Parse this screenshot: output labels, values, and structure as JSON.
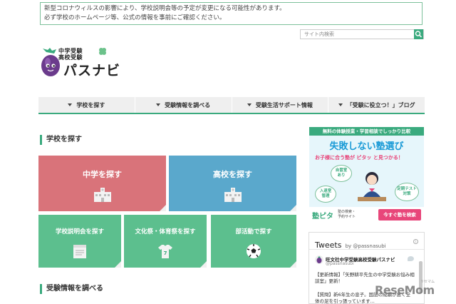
{
  "notice": {
    "line1": "新型コロナウィルスの影響により、学校説明会等の予定が変更になる可能性があります。",
    "line2": "必ず学校のホームページ等、公式の情報を事前にご確認ください。"
  },
  "search": {
    "placeholder": "サイト内検索"
  },
  "logo": {
    "small_line1": "中学受験",
    "small_line2": "高校受験",
    "name": "パスナビ"
  },
  "nav": {
    "items": [
      {
        "label": "学校を探す"
      },
      {
        "label": "受験情報を調べる"
      },
      {
        "label": "受験生活サポート情報"
      },
      {
        "label": "「受験に役立つ！」ブログ"
      }
    ]
  },
  "sections": {
    "find_school": "学校を探す",
    "exam_info": "受験情報を調べる"
  },
  "tiles": {
    "junior_high": "中学を探す",
    "high_school": "高校を探す",
    "info_session": "学校説明会を探す",
    "festival": "文化祭・体育祭を探す",
    "club": "部活動で探す"
  },
  "ad": {
    "top": "無料の体験授業・学習相談でしっかり比較",
    "headline": "失敗しない塾選び",
    "sub": "お子様に合う塾が ピタッ と見つかる！",
    "bubbles": [
      "自習室\nあり",
      "入退室\n管理",
      "定期テスト\n対策"
    ],
    "logo": "塾ピタ",
    "logo_sub": "塾の検索・\n予約サイト",
    "button": "今すぐ塾を検索"
  },
  "tweets": {
    "title": "Tweets",
    "by": "by @passnasubi",
    "account_name": "旺文社中学受験高校受験パスナビ",
    "handle": "@passnasubi",
    "tweet1": "【更新情報】「矢野耕平先生の中学受験お悩み相談室」更新！",
    "tweet2": "【質問】新6年生の息子。国語の成績が悪く全体の足を引っ張っています..."
  },
  "watermark": {
    "text": "ReseMom",
    "sub": "リセマム"
  },
  "colors": {
    "accent": "#3aaa7e",
    "junior_high_tile": "#d9737a",
    "high_school_tile": "#5aa8cc",
    "green_tile": "#5cbf8e",
    "ad_pink": "#e8467a",
    "ad_blue": "#1a9ad6"
  }
}
